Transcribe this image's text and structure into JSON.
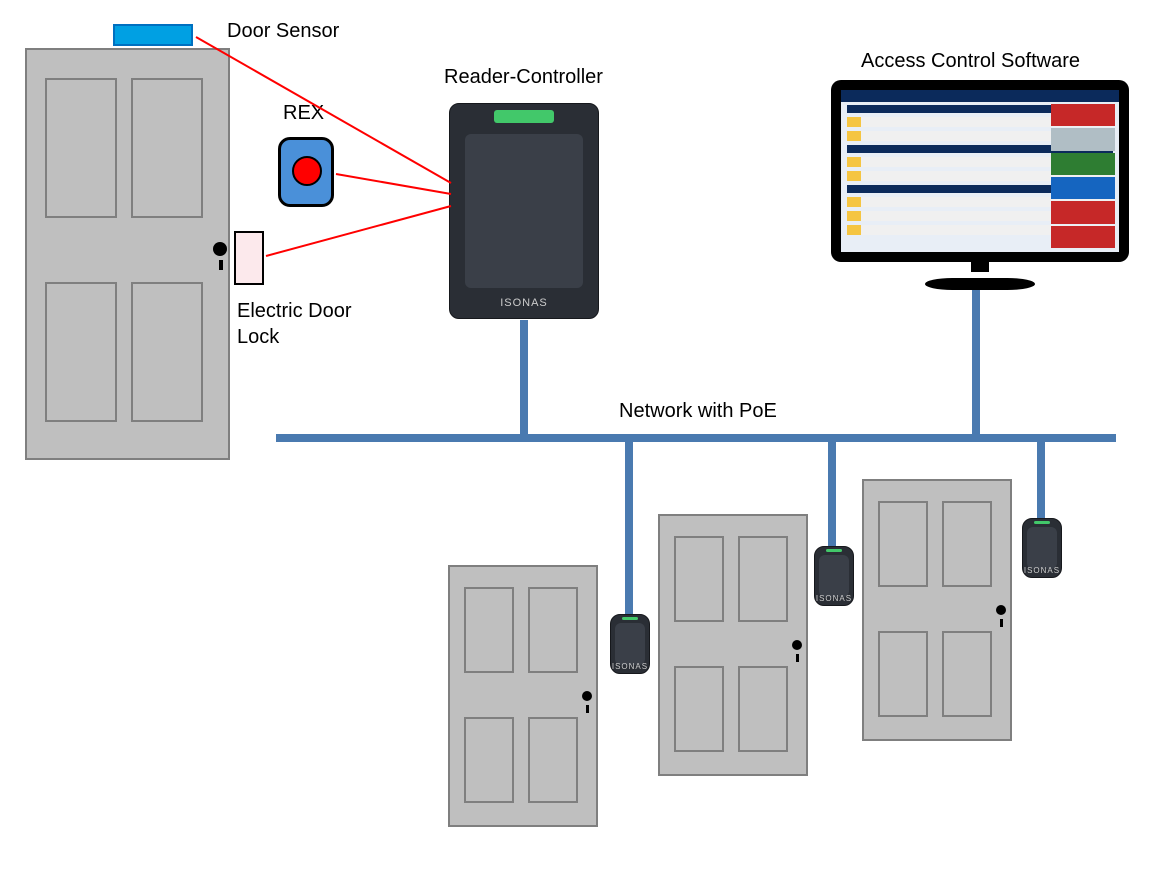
{
  "labels": {
    "door_sensor": "Door Sensor",
    "rex": "REX",
    "reader_controller": "Reader-Controller",
    "access_software": "Access Control Software",
    "electric_lock": "Electric Door\nLock",
    "network": "Network with PoE"
  },
  "reader_brand": "ISONAS",
  "components": {
    "main_door": {
      "type": "door",
      "role": "primary-entry"
    },
    "door_sensor": {
      "type": "sensor",
      "color": "#00a0e3"
    },
    "rex_button": {
      "type": "request-to-exit",
      "led_color": "#ff0000"
    },
    "electric_lock": {
      "type": "electric-strike"
    },
    "reader_controller_main": {
      "type": "reader-controller",
      "brand": "ISONAS"
    },
    "monitor": {
      "type": "software-ui",
      "title": "Access Control Software"
    },
    "network_bus": {
      "type": "poe-network"
    },
    "extra_doors": [
      {
        "door": true,
        "reader": true
      },
      {
        "door": true,
        "reader": true
      },
      {
        "door": true,
        "reader": true
      }
    ]
  },
  "connections": [
    {
      "from": "door_sensor",
      "to": "reader_controller_main",
      "medium": "wire",
      "color": "#ff0000"
    },
    {
      "from": "rex_button",
      "to": "reader_controller_main",
      "medium": "wire",
      "color": "#ff0000"
    },
    {
      "from": "electric_lock",
      "to": "reader_controller_main",
      "medium": "wire",
      "color": "#ff0000"
    },
    {
      "from": "reader_controller_main",
      "to": "network_bus",
      "medium": "poe",
      "color": "#4a7ab0"
    },
    {
      "from": "monitor",
      "to": "network_bus",
      "medium": "ethernet",
      "color": "#4a7ab0"
    },
    {
      "from": "extra_doors.0.reader",
      "to": "network_bus",
      "medium": "poe",
      "color": "#4a7ab0"
    },
    {
      "from": "extra_doors.1.reader",
      "to": "network_bus",
      "medium": "poe",
      "color": "#4a7ab0"
    },
    {
      "from": "extra_doors.2.reader",
      "to": "network_bus",
      "medium": "poe",
      "color": "#4a7ab0"
    }
  ],
  "colors": {
    "network": "#4a7ab0",
    "wire": "#ff0000",
    "door_fill": "#bfbfbf",
    "door_border": "#7f7f7f",
    "reader_body": "#2a2e35",
    "reader_led": "#42c86a"
  }
}
